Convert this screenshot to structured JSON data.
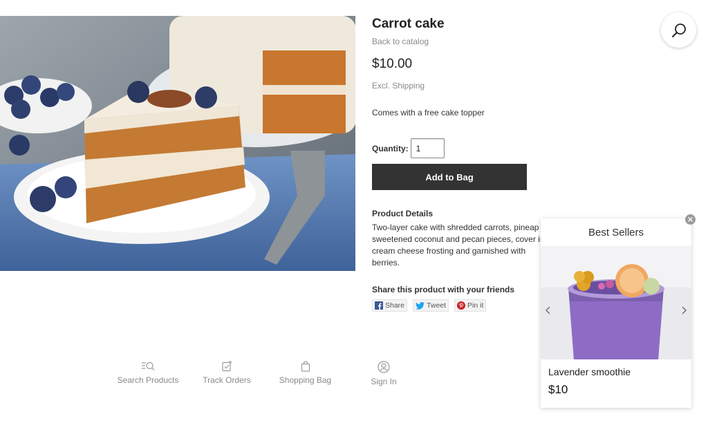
{
  "product": {
    "title": "Carrot cake",
    "back_link": "Back to catalog",
    "price": "$10.00",
    "shipping_note": "Excl. Shipping",
    "promo": "Comes with a free cake topper",
    "quantity_label": "Quantity:",
    "quantity_value": "1",
    "add_button": "Add to Bag",
    "details_heading": "Product Details",
    "details_text": "Two-layer cake with shredded carrots, pineap sweetened coconut and pecan pieces, cover in cream cheese frosting and garnished with berries."
  },
  "share": {
    "heading": "Share this product with your friends",
    "facebook_label": "Share",
    "twitter_label": "Tweet",
    "pinterest_label": "Pin it"
  },
  "nav": {
    "search": "Search Products",
    "track": "Track Orders",
    "bag": "Shopping Bag",
    "signin": "Sign In"
  },
  "popup": {
    "title": "Best Sellers",
    "item_name": "Lavender smoothie",
    "item_price": "$10"
  },
  "colors": {
    "button_bg": "#333333",
    "muted_text": "#8a8a8a",
    "facebook": "#3b5998",
    "twitter": "#1da1f2",
    "pinterest": "#cb2027"
  }
}
